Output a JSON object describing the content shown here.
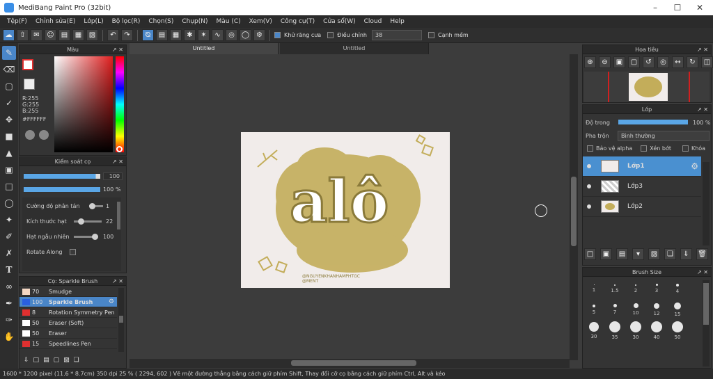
{
  "window": {
    "title": "MediBang Paint Pro (32bit)"
  },
  "menu": [
    "Tệp(F)",
    "Chỉnh sửa(E)",
    "Lớp(L)",
    "Bộ lọc(R)",
    "Chọn(S)",
    "Chụp(N)",
    "Màu (C)",
    "Xem(V)",
    "Công cụ(T)",
    "Cửa sổ(W)",
    "Cloud",
    "Help"
  ],
  "toolbar": {
    "antialias_label": "Khử răng cưa",
    "adjust_label": "Điều chỉnh",
    "adjust_value": "38",
    "edge_label": "Cạnh mềm"
  },
  "color_panel": {
    "title": "Màu",
    "r": "R:255",
    "g": "G:255",
    "b": "B:255",
    "hex": "#FFFFFF"
  },
  "brush_control": {
    "title": "Kiểm soát cọ",
    "size_value": "100",
    "opacity_value": "100 %",
    "params": [
      {
        "label": "Cường độ phân tán",
        "value": "1"
      },
      {
        "label": "Kích thước hạt",
        "value": "22"
      },
      {
        "label": "Hạt ngẫu nhiên",
        "value": "100"
      },
      {
        "label": "Rotate Along",
        "value": ""
      }
    ]
  },
  "brush_list": {
    "title": "Cọ: Sparkle Brush",
    "items": [
      {
        "size": "70",
        "name": "Smudge",
        "color": "#f4d7c3"
      },
      {
        "size": "100",
        "name": "Sparkle Brush",
        "color": "#2a5fe0"
      },
      {
        "size": "8",
        "name": "Rotation Symmetry Pen",
        "color": "#e03030"
      },
      {
        "size": "50",
        "name": "Eraser (Soft)",
        "color": "#ffffff"
      },
      {
        "size": "50",
        "name": "Eraser",
        "color": "#ffffff"
      },
      {
        "size": "15",
        "name": "Speedlines Pen",
        "color": "#e03030"
      }
    ]
  },
  "tabs": [
    "Untitled",
    "Untitled"
  ],
  "artwork": {
    "text": "alô",
    "credit_line1": "@NGUYENKHANHAMPHTGC",
    "credit_line2": "@MENT"
  },
  "navigator": {
    "title": "Hoa tiêu"
  },
  "layers_panel": {
    "title": "Lớp",
    "opacity_label": "Độ trong",
    "opacity_value": "100 %",
    "blend_label": "Pha trộn",
    "blend_value": "Bình thường",
    "protect_alpha": "Bảo vệ alpha",
    "clipping": "Xén bớt",
    "lock": "Khóa",
    "layers": [
      {
        "name": "Lớp1",
        "active": true
      },
      {
        "name": "Lớp3",
        "active": false
      },
      {
        "name": "Lớp2",
        "active": false
      }
    ]
  },
  "brush_size": {
    "title": "Brush Size",
    "labels_row1": [
      "1",
      "1.5",
      "2",
      "3",
      "4"
    ],
    "labels_row2": [
      "5",
      "7",
      "10",
      "12",
      "15"
    ],
    "labels_row3": [
      "30",
      "35",
      "30",
      "40",
      "50"
    ]
  },
  "status": {
    "text": "1600 * 1200 pixel   (11.6 * 8.7cm)  350 dpi  25 %  ( 2294, 602 )  Vẽ một đường thẳng bằng cách giữ phím Shift, Thay đổi cỡ cọ bằng cách giữ phím Ctrl, Alt và kéo"
  },
  "colors": {
    "accent": "#4a86c8",
    "brush_color": "#c3ad5a",
    "paper": "#f1ecea"
  }
}
